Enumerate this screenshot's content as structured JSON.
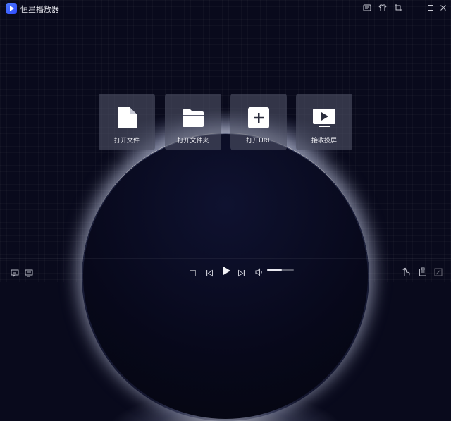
{
  "titlebar": {
    "app_name": "恒星播放器",
    "icons": [
      "message-icon",
      "skin-icon",
      "crop-icon",
      "minimize-icon",
      "maximize-icon",
      "close-icon"
    ]
  },
  "main": {
    "cards": [
      {
        "label": "打开文件",
        "icon": "file-icon"
      },
      {
        "label": "打开文件夹",
        "icon": "folder-icon"
      },
      {
        "label": "打开URL",
        "icon": "add-url-icon"
      },
      {
        "label": "接收投屏",
        "icon": "screen-cast-icon"
      }
    ]
  },
  "controls": {
    "volume_level": 0.55,
    "icons_left": [
      "subtitle-icon",
      "screen-icon"
    ],
    "icons_center": [
      "stop-icon",
      "previous-icon",
      "play-icon",
      "next-icon",
      "volume-icon"
    ],
    "icons_right": [
      "gesture-icon",
      "clipboard-icon",
      "fullscreen-icon"
    ]
  }
}
